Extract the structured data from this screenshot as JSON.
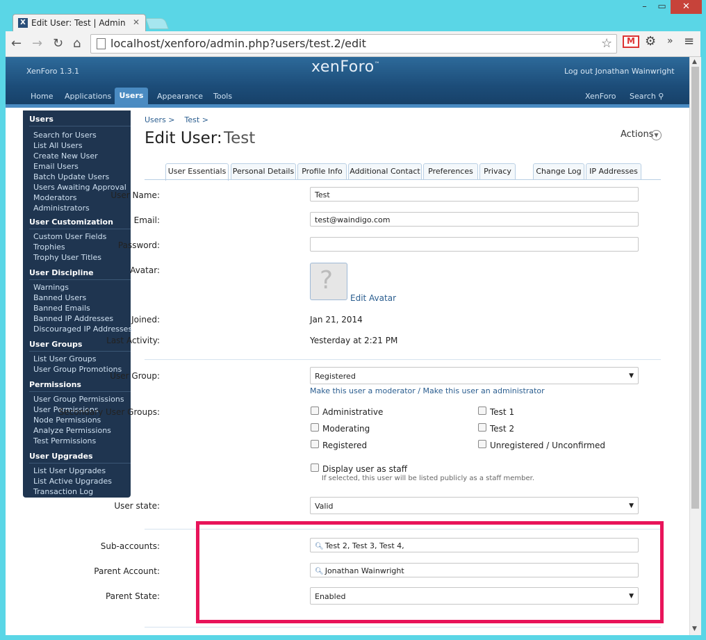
{
  "browser": {
    "tab_title": "Edit User: Test | Admin CP",
    "tab_favicon": "X",
    "url": "localhost/xenforo/admin.php?users/test.2/edit",
    "icons": [
      "back-icon",
      "forward-icon",
      "reload-icon",
      "home-icon",
      "star-icon",
      "gmail-icon",
      "gear-icon",
      "menu-icon"
    ]
  },
  "header": {
    "version": "XenForo 1.3.1",
    "logo": "xenForo",
    "logout": "Log out Jonathan Wainwright",
    "nav": [
      "Home",
      "Applications",
      "Users",
      "Appearance",
      "Tools"
    ],
    "nav_right": [
      "XenForo",
      "Search"
    ]
  },
  "sidebar": {
    "groups": [
      {
        "title": "Users",
        "items": [
          "Search for Users",
          "List All Users",
          "Create New User",
          "Email Users",
          "Batch Update Users",
          "Users Awaiting Approval",
          "Moderators",
          "Administrators"
        ]
      },
      {
        "title": "User Customization",
        "items": [
          "Custom User Fields",
          "Trophies",
          "Trophy User Titles"
        ]
      },
      {
        "title": "User Discipline",
        "items": [
          "Warnings",
          "Banned Users",
          "Banned Emails",
          "Banned IP Addresses",
          "Discouraged IP Addresses"
        ]
      },
      {
        "title": "User Groups",
        "items": [
          "List User Groups",
          "User Group Promotions"
        ]
      },
      {
        "title": "Permissions",
        "items": [
          "User Group Permissions",
          "User Permissions",
          "Node Permissions",
          "Analyze Permissions",
          "Test Permissions"
        ]
      },
      {
        "title": "User Upgrades",
        "items": [
          "List User Upgrades",
          "List Active Upgrades",
          "Transaction Log"
        ]
      }
    ]
  },
  "page": {
    "breadcrumb": [
      "Users >",
      "Test >"
    ],
    "title_prefix": "Edit User:",
    "title_name": "Test",
    "actions": "Actions",
    "tabs": [
      "User Essentials",
      "Personal Details",
      "Profile Info",
      "Additional Contact",
      "Preferences",
      "Privacy"
    ],
    "tabs_right": [
      "Change Log",
      "IP Addresses"
    ]
  },
  "form": {
    "username_label": "User Name:",
    "username": "Test",
    "email_label": "Email:",
    "email": "test@waindigo.com",
    "password_label": "Password:",
    "password": "",
    "avatar_label": "Avatar:",
    "edit_avatar": "Edit Avatar",
    "joined_label": "Joined:",
    "joined": "Jan 21, 2014",
    "last_activity_label": "Last Activity:",
    "last_activity": "Yesterday at 2:21 PM",
    "user_group_label": "User Group:",
    "user_group": "Registered",
    "make_moderator": "Make this user a moderator",
    "sep": "/",
    "make_admin": "Make this user an administrator",
    "secondary_label": "Secondary User Groups:",
    "secondary_groups": [
      "Administrative",
      "Moderating",
      "Registered",
      "Test 1",
      "Test 2",
      "Unregistered / Unconfirmed"
    ],
    "display_staff": "Display user as staff",
    "display_staff_hint": "If selected, this user will be listed publicly as a staff member.",
    "user_state_label": "User state:",
    "user_state": "Valid",
    "sub_accounts_label": "Sub-accounts:",
    "sub_accounts": "Test 2, Test 3, Test 4,",
    "parent_account_label": "Parent Account:",
    "parent_account": "Jonathan Wainwright",
    "parent_state_label": "Parent State:",
    "parent_state": "Enabled"
  },
  "colors": {
    "highlight": "#e8145a",
    "header": "#1c4c78",
    "sidebar": "#1f3550",
    "link": "#2a5d8f"
  }
}
